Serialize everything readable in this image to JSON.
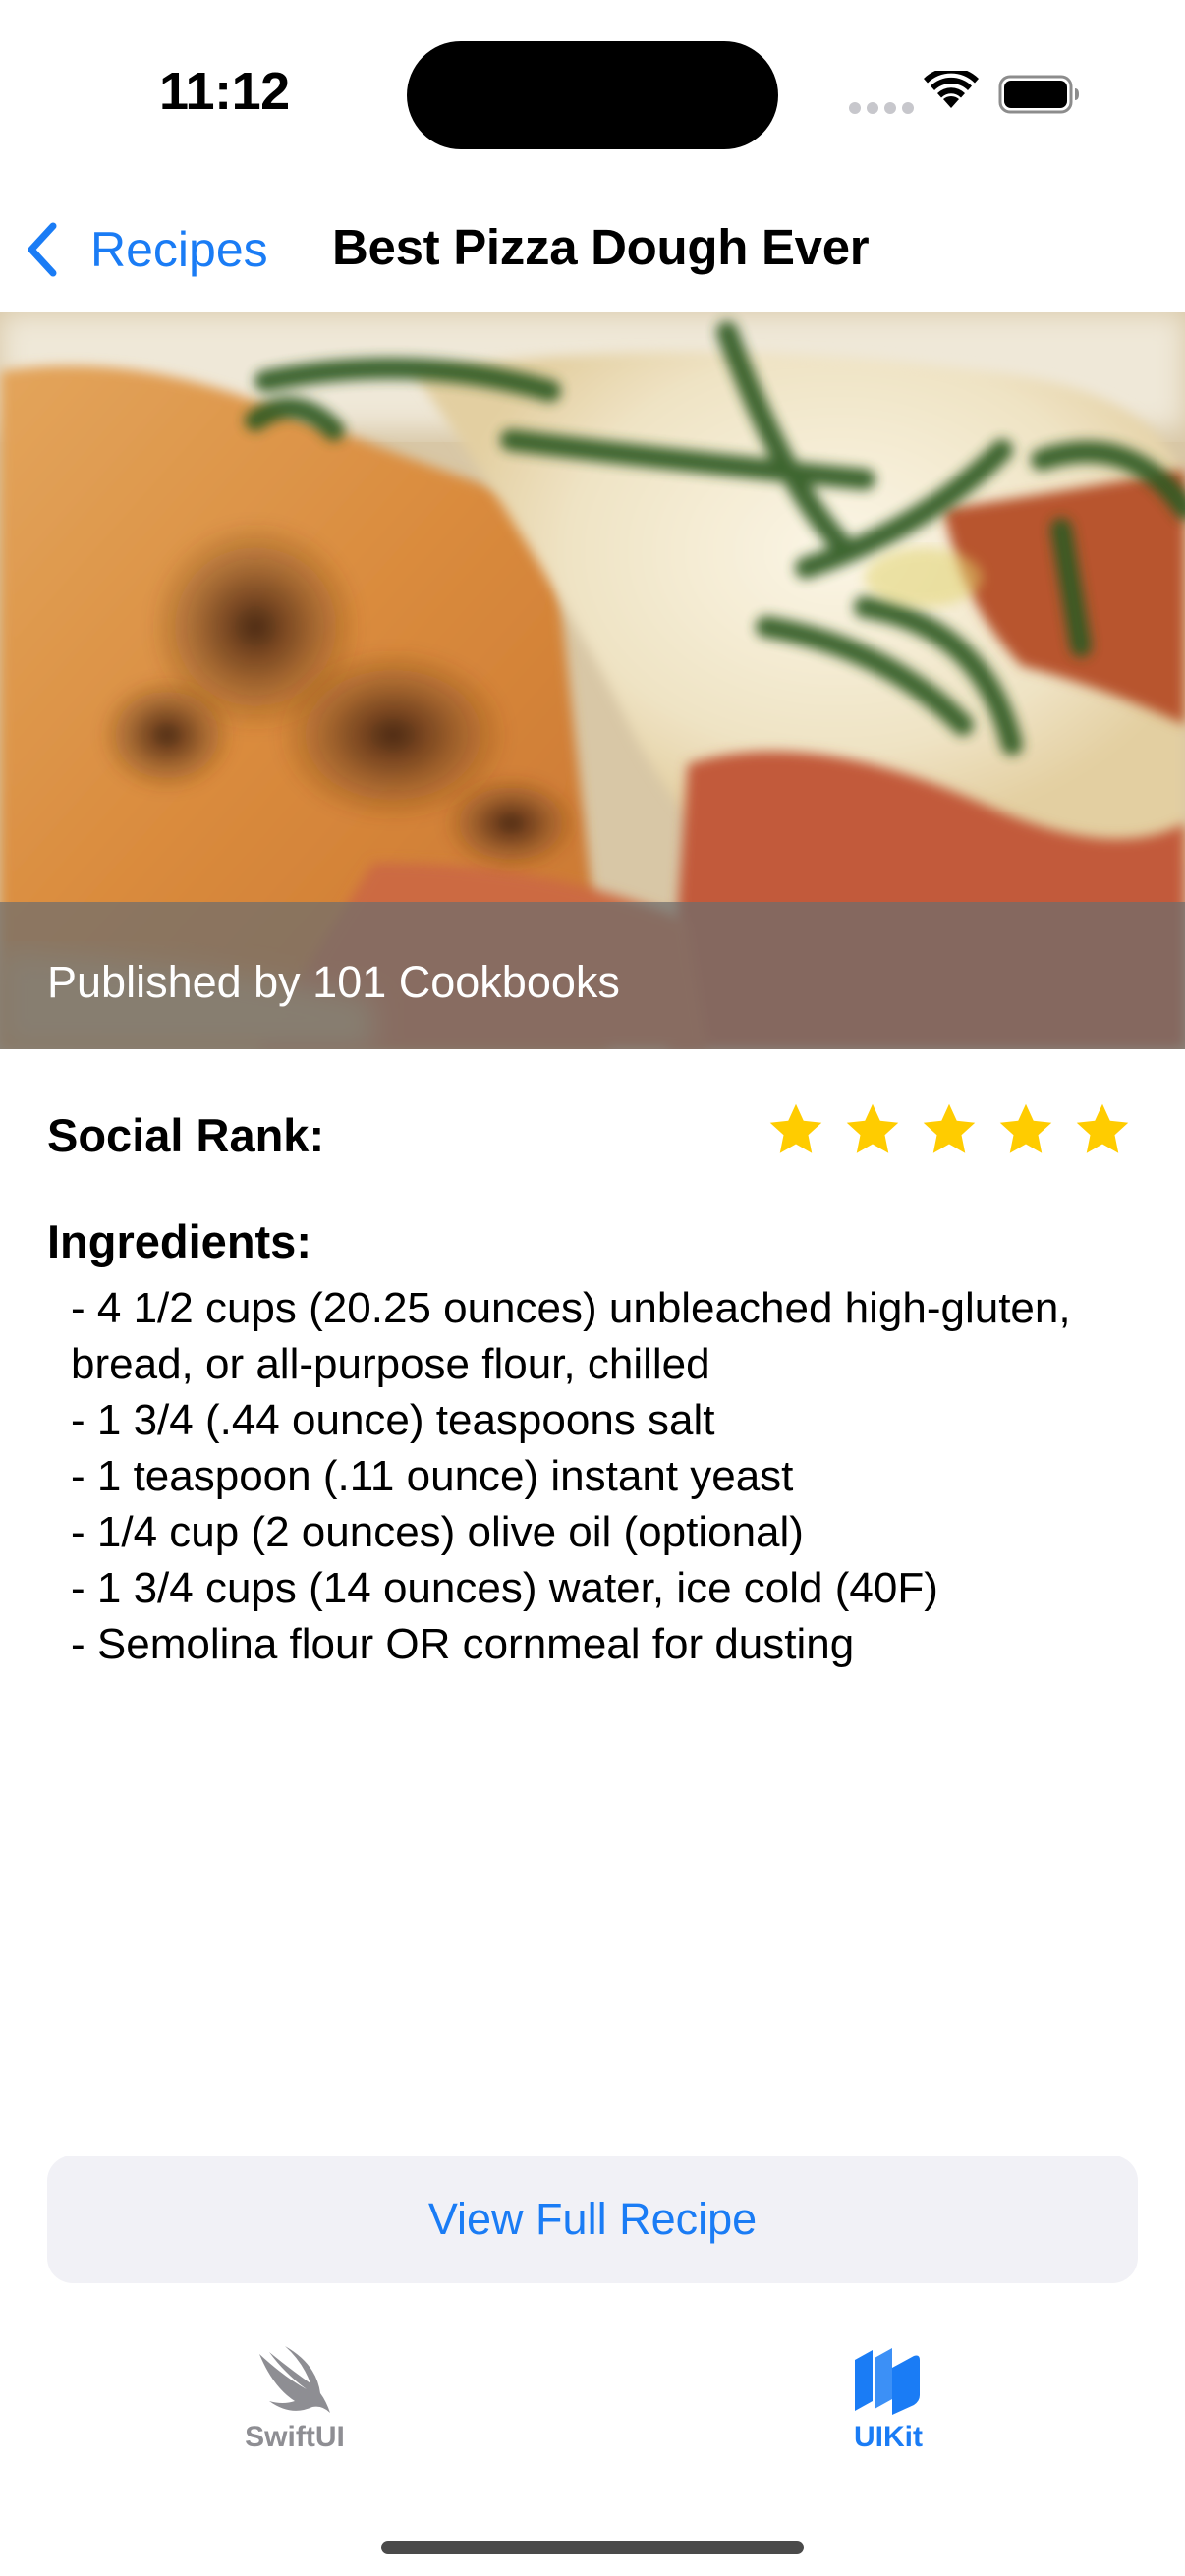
{
  "status_bar": {
    "time": "11:12"
  },
  "nav": {
    "back_label": "Recipes",
    "title": "Best Pizza Dough Ever"
  },
  "hero": {
    "image_subject": "pizza-slice-photo",
    "caption": "Published by 101 Cookbooks"
  },
  "rank": {
    "label": "Social Rank:",
    "stars": 5,
    "max_stars": 5,
    "star_color": "#ffcc00"
  },
  "ingredients": {
    "title": "Ingredients:",
    "items": [
      "- 4 1/2 cups (20.25 ounces) unbleached high-gluten, bread, or all-purpose flour, chilled",
      "- 1 3/4 (.44 ounce) teaspoons salt",
      "- 1 teaspoon (.11 ounce) instant yeast",
      "- 1/4 cup (2 ounces) olive oil (optional)",
      "- 1 3/4 cups (14 ounces) water, ice cold (40F)",
      "- Semolina flour OR cornmeal for dusting"
    ]
  },
  "actions": {
    "full_recipe_label": "View Full Recipe"
  },
  "tabs": [
    {
      "label": "SwiftUI",
      "icon": "swift-icon",
      "selected": false
    },
    {
      "label": "UIKit",
      "icon": "uikit-icon",
      "selected": true
    }
  ],
  "colors": {
    "accent": "#1a7cf5",
    "tab_inactive": "#8e8e93",
    "button_bg": "#f1f1f6"
  }
}
